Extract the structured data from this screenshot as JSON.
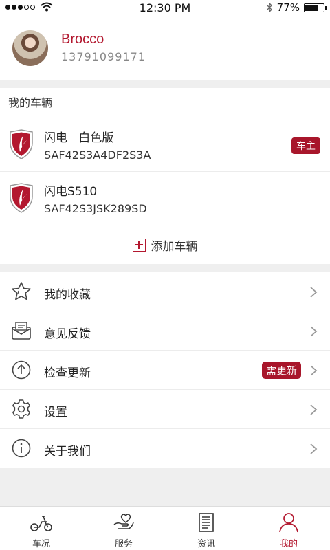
{
  "status_bar": {
    "time": "12:30 PM",
    "battery_text": "77%",
    "battery_level": 0.77,
    "signal_bars_filled": 3,
    "signal_bars_total": 5
  },
  "profile": {
    "name": "Brocco",
    "phone": "13791099171"
  },
  "vehicles": {
    "section_title": "我的车辆",
    "items": [
      {
        "name": "闪电   白色版",
        "vin": "SAF42S3A4DF2S3A",
        "badge": "车主"
      },
      {
        "name": "闪电S510",
        "vin": "SAF42S3JSK289SD",
        "badge": ""
      }
    ],
    "add_label": "添加车辆"
  },
  "menu": {
    "items": [
      {
        "label": "我的收藏",
        "icon": "star-icon",
        "badge": ""
      },
      {
        "label": "意见反馈",
        "icon": "mail-icon",
        "badge": ""
      },
      {
        "label": "检查更新",
        "icon": "upload-arrow-icon",
        "badge": "需更新"
      },
      {
        "label": "设置",
        "icon": "gear-icon",
        "badge": ""
      },
      {
        "label": "关于我们",
        "icon": "info-icon",
        "badge": ""
      }
    ]
  },
  "tabbar": {
    "tabs": [
      {
        "label": "车况",
        "icon": "scooter-icon",
        "active": false
      },
      {
        "label": "服务",
        "icon": "hand-heart-icon",
        "active": false
      },
      {
        "label": "资讯",
        "icon": "news-icon",
        "active": false
      },
      {
        "label": "我的",
        "icon": "person-icon",
        "active": true
      }
    ]
  },
  "colors": {
    "accent": "#b3182f",
    "badge": "#a8162b",
    "background": "#efefef"
  }
}
